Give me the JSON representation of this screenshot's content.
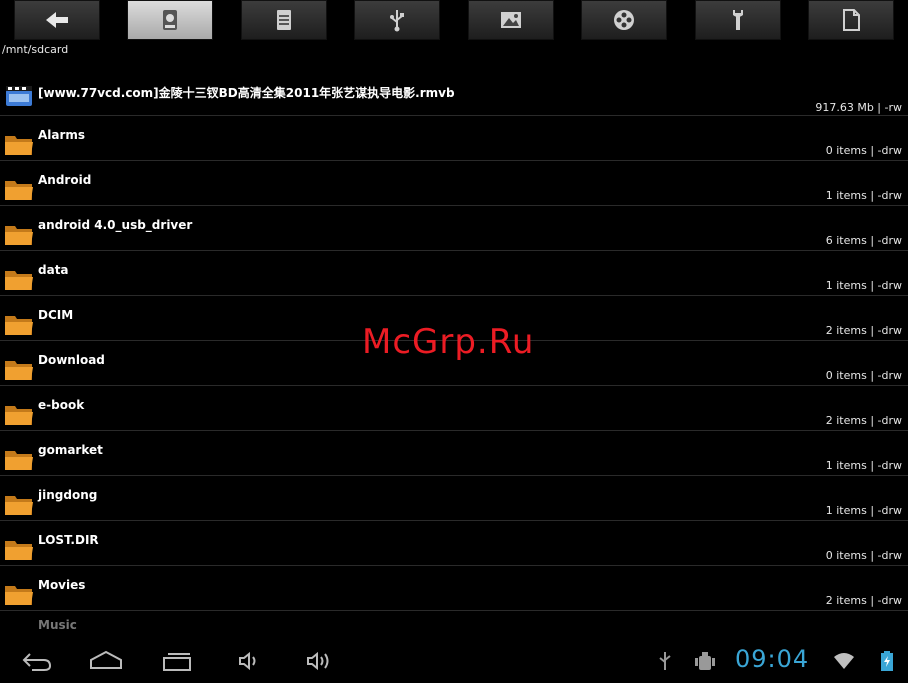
{
  "toolbar": {
    "buttons": [
      {
        "icon": "back-arrow-icon"
      },
      {
        "icon": "sdcard-storage-icon",
        "active": true
      },
      {
        "icon": "document-icon"
      },
      {
        "icon": "usb-icon"
      },
      {
        "icon": "image-icon"
      },
      {
        "icon": "film-reel-icon"
      },
      {
        "icon": "wrench-icon"
      },
      {
        "icon": "blank-file-icon"
      }
    ]
  },
  "path": "/mnt/sdcard",
  "files": [
    {
      "name": "[www.77vcd.com]金陵十三钗BD高清全集2011年张艺谋执导电影.rmvb",
      "meta": "917.63 Mb  | -rw",
      "type": "video"
    },
    {
      "name": "Alarms",
      "meta": "0 items | -drw",
      "type": "folder"
    },
    {
      "name": "Android",
      "meta": "1 items | -drw",
      "type": "folder"
    },
    {
      "name": "android 4.0_usb_driver",
      "meta": "6 items | -drw",
      "type": "folder"
    },
    {
      "name": "data",
      "meta": "1 items | -drw",
      "type": "folder"
    },
    {
      "name": "DCIM",
      "meta": "2 items | -drw",
      "type": "folder"
    },
    {
      "name": "Download",
      "meta": "0 items | -drw",
      "type": "folder"
    },
    {
      "name": "e-book",
      "meta": "2 items | -drw",
      "type": "folder"
    },
    {
      "name": "gomarket",
      "meta": "1 items | -drw",
      "type": "folder"
    },
    {
      "name": "jingdong",
      "meta": "1 items | -drw",
      "type": "folder"
    },
    {
      "name": "LOST.DIR",
      "meta": "0 items | -drw",
      "type": "folder"
    },
    {
      "name": "Movies",
      "meta": "2 items | -drw",
      "type": "folder"
    },
    {
      "name": "Music",
      "meta": "",
      "type": "folder"
    }
  ],
  "watermark": "McGrp.Ru",
  "status": {
    "time": "09:04",
    "clock_color": "#3aa6d6"
  },
  "colors": {
    "folder": "#f0a030",
    "watermark": "#ec1c24"
  }
}
